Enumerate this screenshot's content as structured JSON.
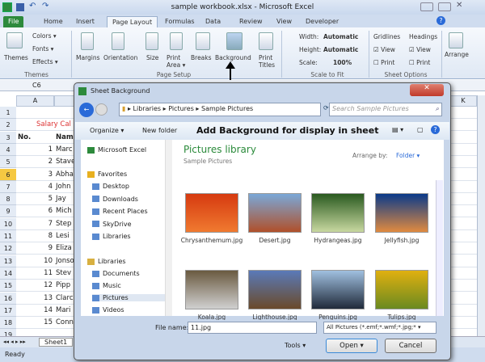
{
  "window": {
    "title": "sample workbook.xlsx - Microsoft Excel"
  },
  "tabs": [
    "File",
    "Home",
    "Insert",
    "Page Layout",
    "Formulas",
    "Data",
    "Review",
    "View",
    "Developer"
  ],
  "ribbon": {
    "themes": {
      "themes": "Themes",
      "colors": "Colors ▾",
      "fonts": "Fonts ▾",
      "effects": "Effects ▾",
      "group": "Themes"
    },
    "page_setup": {
      "margins": "Margins",
      "orientation": "Orientation",
      "size": "Size",
      "print_area": "Print Area ▾",
      "breaks": "Breaks",
      "background": "Background",
      "print_titles": "Print Titles",
      "group": "Page Setup"
    },
    "scale": {
      "width_label": "Width:",
      "width_value": "Automatic",
      "height_label": "Height:",
      "height_value": "Automatic",
      "scale_label": "Scale:",
      "scale_value": "100%",
      "group": "Scale to Fit"
    },
    "sheet_options": {
      "gridlines": "Gridlines",
      "headings": "Headings",
      "view": "View",
      "print": "Print",
      "gridlines_view": true,
      "headings_view": true,
      "group": "Sheet Options"
    },
    "arrange": "Arrange"
  },
  "name_box": "C6",
  "sheet": {
    "columns": [
      "A",
      "K"
    ],
    "rows": [
      "1",
      "2",
      "3",
      "4",
      "5",
      "6",
      "7",
      "8",
      "9",
      "10",
      "11",
      "12",
      "13",
      "14",
      "15",
      "16",
      "17",
      "18",
      "19"
    ],
    "title": "Salary Cal",
    "header_no": "No.",
    "header_name": "Nam",
    "data": [
      [
        "1",
        "Marc"
      ],
      [
        "2",
        "Stave"
      ],
      [
        "3",
        "Abha"
      ],
      [
        "4",
        "John"
      ],
      [
        "5",
        "Jay"
      ],
      [
        "6",
        "Mich"
      ],
      [
        "7",
        "Step"
      ],
      [
        "8",
        "Lesi"
      ],
      [
        "9",
        "Eliza"
      ],
      [
        "10",
        "Jonso"
      ],
      [
        "11",
        "Stev"
      ],
      [
        "12",
        "Pipp"
      ],
      [
        "13",
        "Clarc"
      ],
      [
        "14",
        "Mari"
      ],
      [
        "15",
        "Conn"
      ]
    ],
    "selected_row": "6"
  },
  "sheet_tab": "Sheet1",
  "status": "Ready",
  "dialog": {
    "title": "Sheet Background",
    "breadcrumb": [
      "Libraries",
      "Pictures",
      "Sample Pictures"
    ],
    "search_placeholder": "Search Sample Pictures",
    "organize": "Organize ▾",
    "new_folder": "New folder",
    "annotation": "Add Background for display in sheet",
    "nav": {
      "excel": "Microsoft Excel",
      "favorites": "Favorites",
      "fav_items": [
        "Desktop",
        "Downloads",
        "Recent Places",
        "SkyDrive",
        "Libraries"
      ],
      "libraries": "Libraries",
      "lib_items": [
        "Documents",
        "Music",
        "Pictures",
        "Videos"
      ]
    },
    "library_title": "Pictures library",
    "library_sub": "Sample Pictures",
    "arrange_by": "Arrange by:",
    "arrange_value": "Folder ▾",
    "files": [
      {
        "name": "Chrysanthemum.jpg",
        "colors": [
          "#d63a10",
          "#f07a30"
        ]
      },
      {
        "name": "Desert.jpg",
        "colors": [
          "#7aa8d8",
          "#b0502a"
        ]
      },
      {
        "name": "Hydrangeas.jpg",
        "colors": [
          "#2a5a20",
          "#c8d8a0"
        ]
      },
      {
        "name": "Jellyfish.jpg",
        "colors": [
          "#0a3a8a",
          "#e08a40"
        ]
      },
      {
        "name": "Koala.jpg",
        "colors": [
          "#6a5a40",
          "#d0d0d0"
        ]
      },
      {
        "name": "Lighthouse.jpg",
        "colors": [
          "#5a7ab8",
          "#6a4a2a"
        ]
      },
      {
        "name": "Penguins.jpg",
        "colors": [
          "#a0c0e0",
          "#202a3a"
        ]
      },
      {
        "name": "Tulips.jpg",
        "colors": [
          "#e0b010",
          "#6a8a20"
        ]
      }
    ],
    "file_name_label": "File name:",
    "file_name_value": "11.jpg",
    "filter": "All Pictures (*.emf;*.wmf;*.jpg;*",
    "tools": "Tools",
    "open": "Open",
    "cancel": "Cancel"
  }
}
